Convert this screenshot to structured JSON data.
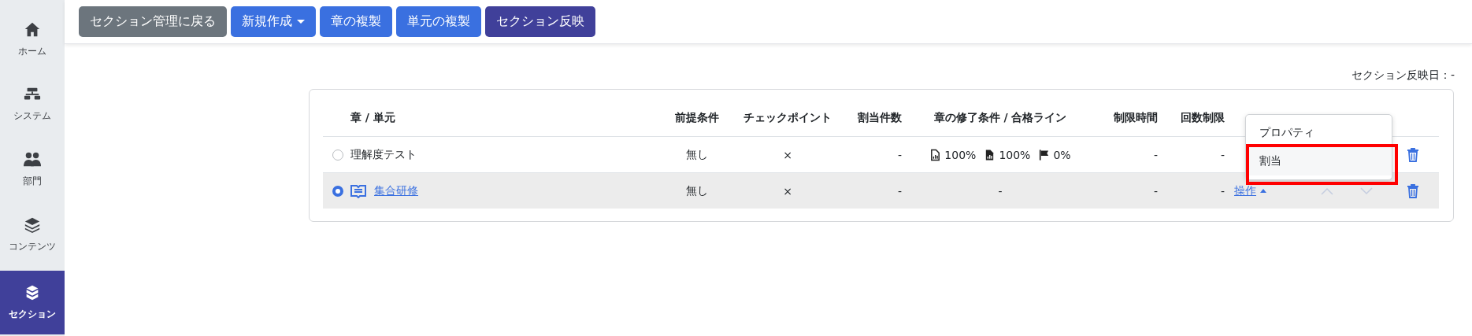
{
  "sidebar": {
    "items": [
      {
        "label": "ホーム",
        "kind": "home",
        "selected": false
      },
      {
        "label": "システム",
        "kind": "system",
        "selected": false
      },
      {
        "label": "部門",
        "kind": "department",
        "selected": false
      },
      {
        "label": "コンテンツ",
        "kind": "contents",
        "selected": false
      },
      {
        "label": "セクション",
        "kind": "section",
        "selected": true
      }
    ]
  },
  "toolbar": {
    "buttons": [
      {
        "label": "セクション管理に戻る",
        "kind": "back",
        "dropdown": false
      },
      {
        "label": "新規作成",
        "kind": "create",
        "dropdown": true
      },
      {
        "label": "章の複製",
        "kind": "copy",
        "dropdown": false
      },
      {
        "label": "単元の複製",
        "kind": "copy",
        "dropdown": false
      },
      {
        "label": "セクション反映",
        "kind": "apply",
        "dropdown": false
      }
    ]
  },
  "reflect_date": "セクション反映日：-",
  "table": {
    "columns": [
      "章 / 単元",
      "前提条件",
      "チェックポイント",
      "割当件数",
      "章の修了条件 / 合格ライン",
      "制限時間",
      "回数制限"
    ],
    "rows": [
      {
        "kind": "chapter",
        "selected": false,
        "title": "理解度テスト",
        "prerequisite": "無し",
        "checkpoint": "×",
        "assigned": "-",
        "completion": [
          {
            "kind": "file-chart",
            "text": "100%"
          },
          {
            "kind": "file-solid",
            "text": "100%"
          },
          {
            "kind": "flag",
            "text": "0%"
          }
        ],
        "time_limit": "-",
        "attempt_limit": "-"
      },
      {
        "kind": "unit",
        "selected": true,
        "title": "集合研修",
        "prerequisite": "無し",
        "checkpoint": "×",
        "assigned": "-",
        "completion_text": "-",
        "time_limit": "-",
        "attempt_limit": "-",
        "menu_label": "操作",
        "move_disabled": true
      }
    ]
  },
  "dropdown": {
    "items": [
      {
        "label": "プロパティ",
        "highlighted": false
      },
      {
        "label": "割当",
        "highlighted": true
      }
    ]
  }
}
